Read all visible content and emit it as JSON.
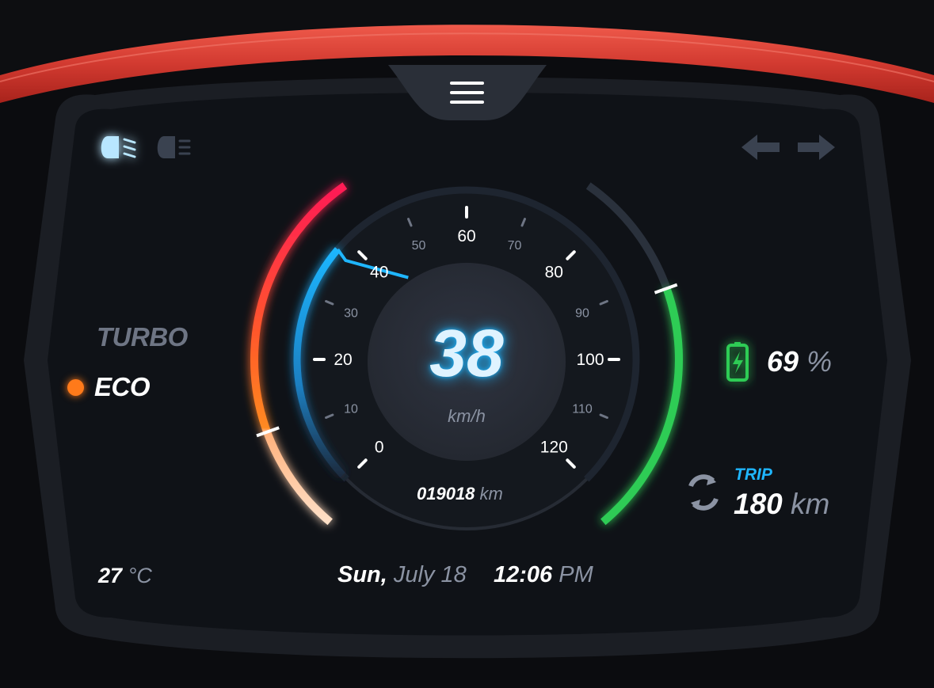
{
  "menu": {
    "icon": "hamburger-menu-icon"
  },
  "headlights": {
    "high_beam": {
      "icon": "high-beam-icon",
      "active": true
    },
    "low_beam": {
      "icon": "low-beam-icon",
      "active": false
    }
  },
  "turn_signals": {
    "left_icon": "turn-left-arrow-icon",
    "right_icon": "turn-right-arrow-icon"
  },
  "modes": {
    "turbo": "TURBO",
    "eco": "ECO",
    "active": "ECO",
    "active_color": "#ff7a1a"
  },
  "speedometer": {
    "speed": "38",
    "unit": "km/h",
    "max": 120,
    "value": 38,
    "major_ticks": [
      "0",
      "20",
      "40",
      "60",
      "80",
      "100",
      "120"
    ],
    "minor_ticks": [
      "10",
      "30",
      "50",
      "70",
      "90",
      "110"
    ],
    "odometer_value": "019018",
    "odometer_unit": "km"
  },
  "battery": {
    "icon": "battery-charging-icon",
    "value": "69",
    "unit": "%",
    "level": 0.69,
    "color": "#2ecc55"
  },
  "trip": {
    "icon": "refresh-icon",
    "label": "TRIP",
    "value": "180",
    "unit": "km",
    "label_color": "#1fb6ff"
  },
  "temperature": {
    "value": "27",
    "unit": "°C"
  },
  "datetime": {
    "day": "Sun,",
    "date": "July 18",
    "time": "12:06",
    "period": "PM"
  },
  "colors": {
    "accent_red": "#e2453a",
    "speed_blue": "#1fb6ff",
    "battery_green": "#2ecc55",
    "background": "#0d0e11",
    "panel": "#12151b"
  }
}
